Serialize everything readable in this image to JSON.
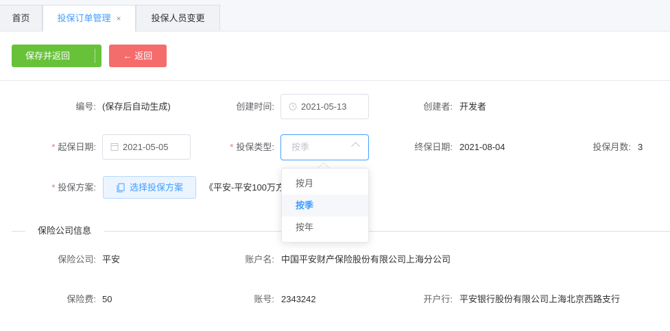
{
  "tabs": [
    {
      "label": "首页"
    },
    {
      "label": "投保订单管理",
      "close": "×"
    },
    {
      "label": "投保人员变更"
    }
  ],
  "toolbar": {
    "save_label": "保存并返回",
    "save_chevron": "⌵",
    "back_arrow": "←",
    "back_label": "返回"
  },
  "form": {
    "code_label": "编号:",
    "code_value": "(保存后自动生成)",
    "created_time_label": "创建时间:",
    "created_time_value": "2021-05-13",
    "creator_label": "创建者:",
    "creator_value": "开发者",
    "start_date_label": "起保日期:",
    "start_date_value": "2021-05-05",
    "insure_type_label": "投保类型:",
    "insure_type_placeholder": "按季",
    "end_date_label": "终保日期:",
    "end_date_value": "2021-08-04",
    "months_label": "投保月数:",
    "months_value": "3",
    "plan_label": "投保方案:",
    "plan_button": "选择投保方案",
    "plan_value": "《平安-平安100万方"
  },
  "dropdown": {
    "options": [
      "按月",
      "按季",
      "按年"
    ],
    "selected": "按季"
  },
  "company": {
    "section_title": "保险公司信息",
    "company_label": "保险公司:",
    "company_value": "平安",
    "account_name_label": "账户名:",
    "account_name_value": "中国平安财产保险股份有限公司上海分公司",
    "fee_label": "保险费:",
    "fee_value": "50",
    "account_no_label": "账号:",
    "account_no_value": "2343242",
    "bank_label": "开户行:",
    "bank_value": "平安银行股份有限公司上海北京西路支行"
  },
  "colors": {
    "primary": "#409eff",
    "success": "#67c23a",
    "danger": "#f56c6c"
  }
}
